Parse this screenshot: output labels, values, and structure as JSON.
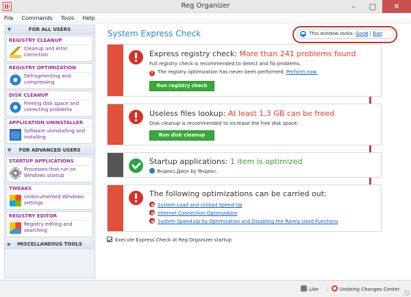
{
  "window": {
    "title": "Reg Organizer"
  },
  "menu": [
    "File",
    "Commands",
    "Tools",
    "Help"
  ],
  "sidebar": {
    "sections": [
      {
        "label": "FOR ALL USERS"
      },
      {
        "label": "FOR ADVANCED USERS"
      },
      {
        "label": "MISCELLANEOUS TOOLS"
      }
    ],
    "items": [
      {
        "title": "REGISTRY CLEANUP",
        "desc": "Cleanup and error correction",
        "icon": "broom-icon"
      },
      {
        "title": "REGISTRY OPTIMIZATION",
        "desc": "Defragmenting and compressing",
        "icon": "disk-optimize-icon"
      },
      {
        "title": "DISK CLEANUP",
        "desc": "Freeing disk space and correcting problems",
        "icon": "disk-icon"
      },
      {
        "title": "APPLICATION UNINSTALLER",
        "desc": "Software uninstalling and installing",
        "icon": "uninstall-icon"
      },
      {
        "title": "STARTUP APPLICATIONS",
        "desc": "Processes that run on Windows startup",
        "icon": "gear-icon"
      },
      {
        "title": "TWEAKS",
        "desc": "Undocumented Windows settings",
        "icon": "wrench-icon"
      },
      {
        "title": "REGISTRY EDITOR",
        "desc": "Registry editing and searching",
        "icon": "registry-editor-icon"
      }
    ]
  },
  "main": {
    "title": "System Express Check",
    "look": {
      "prefix": "This window looks:",
      "good": "Good",
      "separator": "|",
      "bad": "Bad"
    },
    "registry_card": {
      "title_prefix": "Express registry check:",
      "title_highlight": "More than 241 problems found",
      "line1": "Full registry check is recommended to detect and fix problems.",
      "line2_text": "The registry optimization has never been performed.",
      "line2_link": "Perform now.",
      "button": "Run registry check"
    },
    "files_card": {
      "title_prefix": "Useless files lookup:",
      "title_highlight": "At least 1,3 GB can be freed",
      "line1": "Disk cleanup is recommended to increase the free disk space.",
      "button": "Run disk cleanup"
    },
    "startup_card": {
      "title_prefix": "Startup applications:",
      "title_highlight": "1 item is optimized",
      "line1": "Яндекс.Диск by Яндекс."
    },
    "optim_card": {
      "title": "The following optimizations can be carried out:",
      "links": [
        "System Load and Unload Speed-Up",
        "Internet Connection Optimization",
        "System Speed-Up by Optimization and Disabling the Rarely Used Functions"
      ]
    },
    "startup_checkbox": {
      "label": "Execute Express Check at Reg Organizer startup",
      "checked": true
    }
  },
  "statusbar": {
    "like": "Like",
    "undo": "Undoing Changes Center"
  },
  "colors": {
    "accent_blue": "#2e87c8",
    "alert_red": "#e53b2c",
    "ok_green": "#3a9e2a",
    "button_green": "#3aa83a",
    "sidebar_title_purple": "#9a2d9a",
    "annotation_red": "#b03a2a"
  }
}
